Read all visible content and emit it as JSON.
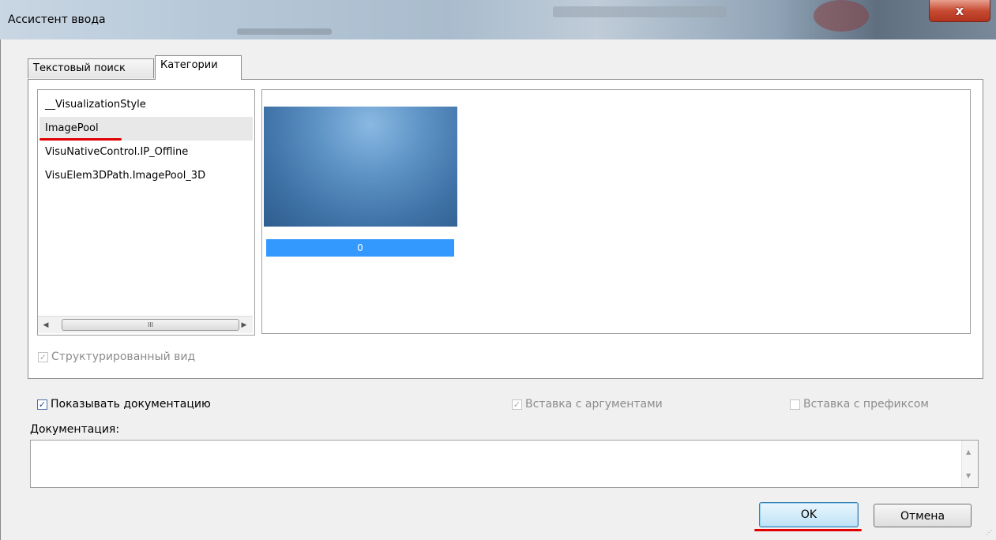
{
  "window": {
    "title": "Ассистент ввода",
    "close_glyph": "x"
  },
  "tabs": [
    {
      "label": "Текстовый поиск",
      "active": false
    },
    {
      "label": "Категории",
      "active": true
    }
  ],
  "categories": {
    "items": [
      {
        "label": "__VisualizationStyle",
        "selected": false
      },
      {
        "label": "ImagePool",
        "selected": true
      },
      {
        "label": "VisuNativeControl.IP_Offline",
        "selected": false
      },
      {
        "label": "VisuElem3DPath.ImagePool_3D",
        "selected": false
      }
    ],
    "scrollbar_thumb_glyph": "III"
  },
  "image_panel": {
    "caption": "0"
  },
  "options": {
    "structured_view": {
      "label": "Структурированный вид",
      "checked": true,
      "enabled": false
    },
    "show_docs": {
      "label": "Показывать документацию",
      "checked": true,
      "enabled": true
    },
    "insert_with_args": {
      "label": "Вставка с аргументами",
      "checked": true,
      "enabled": false
    },
    "insert_with_prefix": {
      "label": "Вставка с префиксом",
      "checked": false,
      "enabled": false
    }
  },
  "documentation": {
    "label": "Документация:",
    "value": ""
  },
  "buttons": {
    "ok": "OK",
    "cancel": "Отмена"
  },
  "colors": {
    "accent_red": "#e00000",
    "selection_blue": "#3399ff"
  }
}
